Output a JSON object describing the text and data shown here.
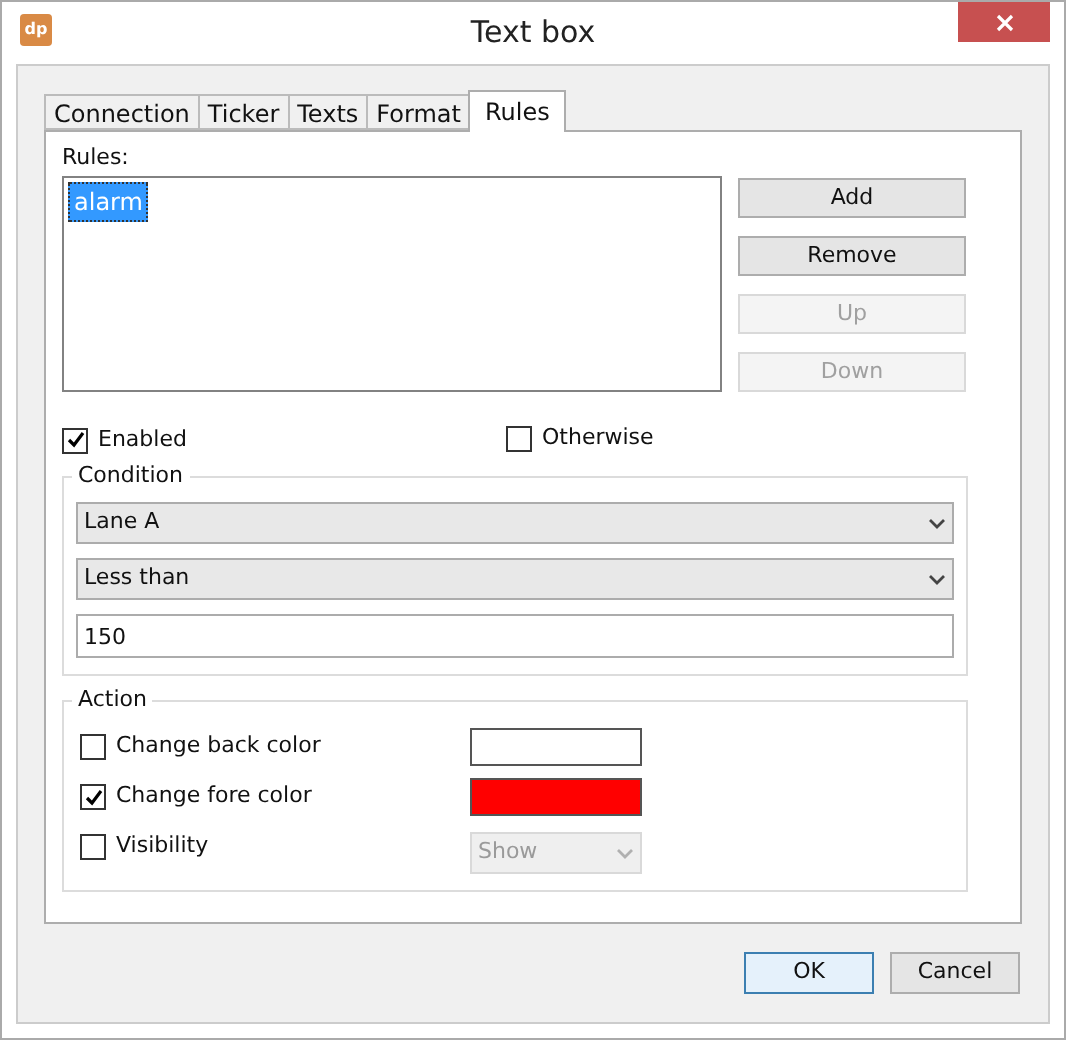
{
  "window": {
    "title": "Text box",
    "app_icon": "dp"
  },
  "tabs": [
    {
      "label": "Connection",
      "selected": false
    },
    {
      "label": "Ticker",
      "selected": false
    },
    {
      "label": "Texts",
      "selected": false
    },
    {
      "label": "Format",
      "selected": false
    },
    {
      "label": "Rules",
      "selected": true
    }
  ],
  "rules": {
    "label": "Rules:",
    "items": [
      {
        "text": "alarm",
        "selected": true
      }
    ],
    "buttons": [
      {
        "label": "Add",
        "disabled": false
      },
      {
        "label": "Remove",
        "disabled": false
      },
      {
        "label": "Up",
        "disabled": true
      },
      {
        "label": "Down",
        "disabled": true
      }
    ]
  },
  "enabled": {
    "label": "Enabled",
    "checked": true
  },
  "otherwise": {
    "label": "Otherwise",
    "checked": false
  },
  "condition": {
    "title": "Condition",
    "source": "Lane A",
    "operator": "Less than",
    "value": "150"
  },
  "action": {
    "title": "Action",
    "rows": [
      {
        "kind": "color",
        "label": "Change back color",
        "checked": false,
        "color": "#ffffff"
      },
      {
        "kind": "color",
        "label": "Change fore color",
        "checked": true,
        "color": "#ff0000"
      },
      {
        "kind": "select",
        "label": "Visibility",
        "checked": false,
        "value": "Show",
        "disabled": true
      }
    ]
  },
  "buttons": [
    {
      "label": "OK",
      "default": true
    },
    {
      "label": "Cancel",
      "default": false
    }
  ]
}
